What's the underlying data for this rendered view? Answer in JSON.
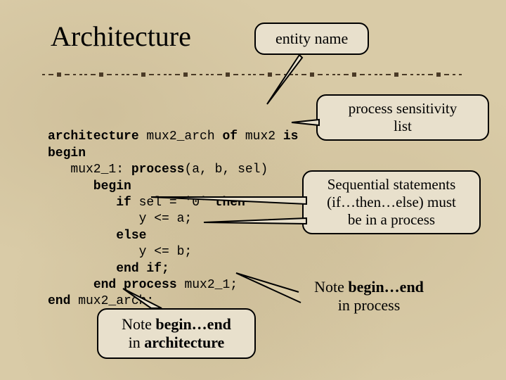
{
  "title": "Architecture",
  "callouts": {
    "entity": "entity name",
    "sensitivity": "process sensitivity\nlist",
    "sequential": "Sequential statements\n(if…then…else) must\nbe in a process",
    "note_process_l1": "Note ",
    "note_process_bold": "begin…end",
    "note_process_l2": "in process",
    "note_arch_l1": "Note ",
    "note_arch_bold": "begin…end",
    "note_arch_l2a": "in ",
    "note_arch_l2b": "architecture"
  },
  "code": {
    "l1a": "architecture",
    "l1b": " mux2_arch ",
    "l1c": "of",
    "l1d": " mux2 ",
    "l1e": "is",
    "l2": "begin",
    "l3a": "   mux2_1: ",
    "l3b": "process",
    "l3c": "(a, b, sel)",
    "l4": "      begin",
    "l5a": "         ",
    "l5b": "if",
    "l5c": " sel = '0' ",
    "l5d": "then",
    "l6": "            y <= a;",
    "l7": "         else",
    "l8": "            y <= b;",
    "l9": "         end if;",
    "l10a": "      ",
    "l10b": "end process",
    "l10c": " mux2_1;",
    "l11a": "end",
    "l11b": " mux2_arch;"
  }
}
